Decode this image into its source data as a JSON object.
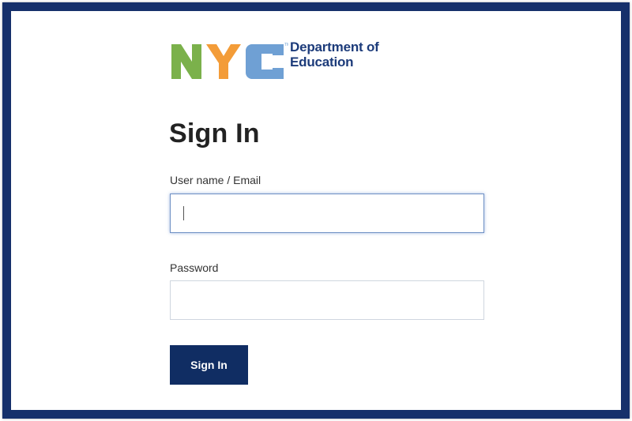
{
  "logo": {
    "line1": "Department of",
    "line2": "Education",
    "colors": {
      "n": "#7bb14b",
      "y": "#f39c38",
      "c": "#6fa0d4",
      "text": "#1c3b7a"
    }
  },
  "form": {
    "title": "Sign In",
    "username_label": "User name / Email",
    "username_value": "",
    "password_label": "Password",
    "password_value": "",
    "submit_label": "Sign In"
  },
  "colors": {
    "frame": "#16306b",
    "button": "#102d63"
  }
}
